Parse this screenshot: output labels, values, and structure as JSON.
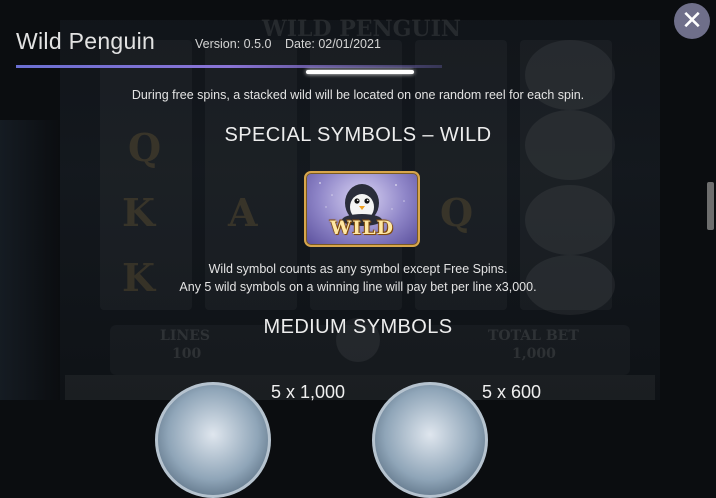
{
  "header": {
    "title": "Wild Penguin",
    "version_label": "Version: 0.5.0",
    "date_label": "Date: 02/01/2021",
    "accent_color": "#7a72d4"
  },
  "close_button": {
    "icon": "close-icon",
    "glyph": "✕"
  },
  "content": {
    "free_spins_text": "During free spins, a stacked wild will be located on one random reel for each spin.",
    "special_heading": "SPECIAL SYMBOLS – WILD",
    "wild_symbol_label": "WILD",
    "wild_desc_line1": "Wild symbol counts as any symbol except Free Spins.",
    "wild_desc_line2": "Any 5 wild symbols on a winning line will pay bet per line x3,000.",
    "medium_heading": "MEDIUM SYMBOLS",
    "medium_symbols": [
      {
        "payout": "5 x 1,000"
      },
      {
        "payout": "5 x 600"
      }
    ]
  },
  "background_game": {
    "logo_text": "WILD PENGUIN",
    "lines_label": "LINES",
    "lines_value": "100",
    "total_bet_label": "TOTAL BET",
    "total_bet_value": "1,000"
  }
}
